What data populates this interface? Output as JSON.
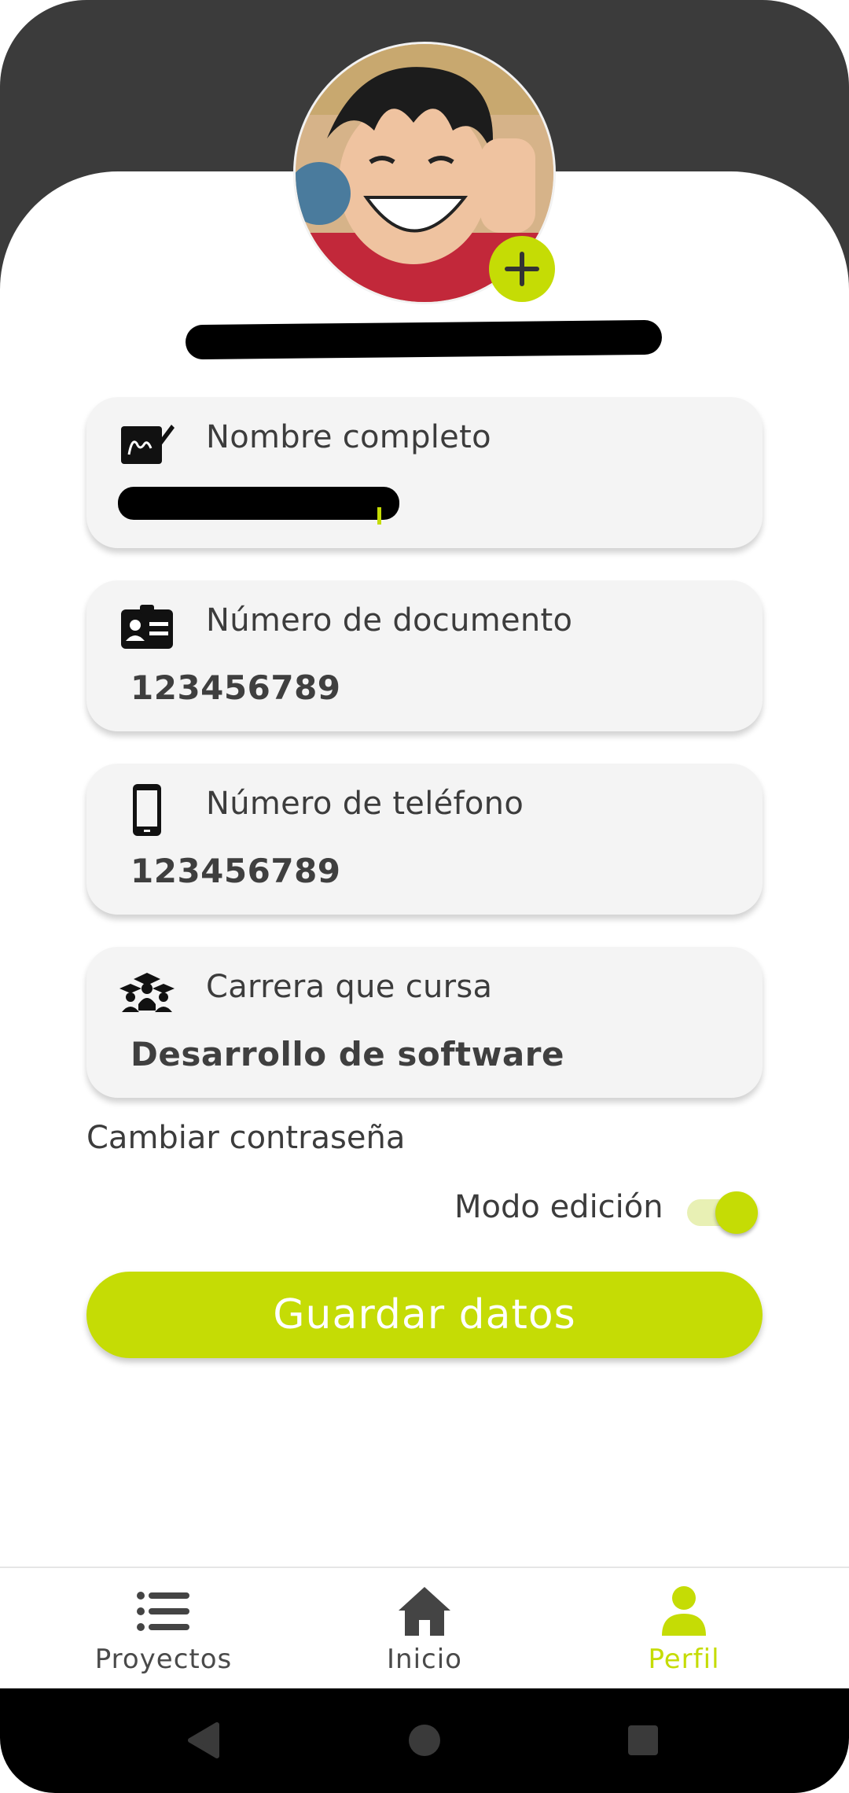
{
  "profile": {
    "avatar_alt": "profile-photo",
    "email_redacted": ""
  },
  "fields": [
    {
      "label": "Nombre completo",
      "value": ""
    },
    {
      "label": "Número de documento",
      "value": "123456789"
    },
    {
      "label": "Número de teléfono",
      "value": "123456789"
    },
    {
      "label": "Carrera que cursa",
      "value": "Desarrollo de software"
    }
  ],
  "change_password": "Cambiar contraseña",
  "edit_mode": {
    "label": "Modo edición",
    "enabled": true
  },
  "save_button": "Guardar datos",
  "bottom_nav": [
    {
      "label": "Proyectos",
      "icon": "list-icon",
      "active": false
    },
    {
      "label": "Inicio",
      "icon": "home-icon",
      "active": false
    },
    {
      "label": "Perfil",
      "icon": "person-icon",
      "active": true
    }
  ],
  "colors": {
    "accent": "#c5dc05",
    "header": "#3b3b3b",
    "card": "#f4f4f4"
  }
}
